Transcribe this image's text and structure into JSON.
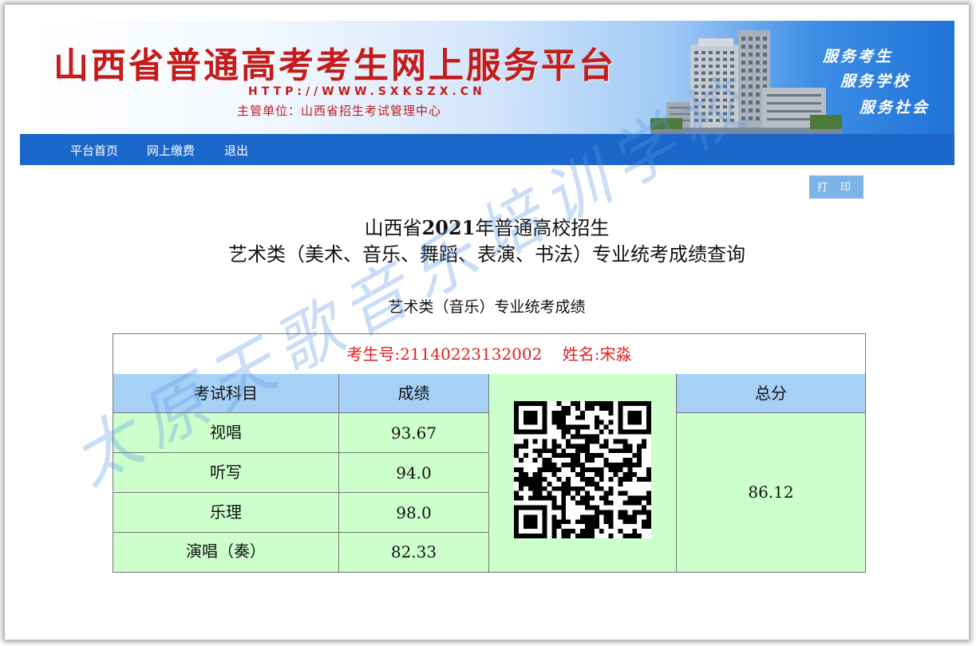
{
  "banner": {
    "title": "山西省普通高考考生网上服务平台",
    "url": "HTTP://WWW.SXKSZX.CN",
    "org": "主管单位：山西省招生考试管理中心",
    "slogans": [
      "服务考生",
      "服务学校",
      "服务社会"
    ]
  },
  "nav": {
    "items": [
      {
        "label": "平台首页"
      },
      {
        "label": "网上缴费"
      },
      {
        "label": "退出"
      }
    ]
  },
  "actions": {
    "print_label": "打 印"
  },
  "page": {
    "title_line1_pre": "山西省",
    "title_line1_year": "2021",
    "title_line1_post": "年普通高校招生",
    "title_line2": "艺术类（美术、音乐、舞蹈、表演、书法）专业统考成绩查询",
    "subtitle": "艺术类（音乐）专业统考成绩"
  },
  "result": {
    "candidate_line": "考生号:21140223132002    姓名:宋淼",
    "headers": {
      "subject": "考试科目",
      "score": "成绩",
      "total": "总分"
    },
    "rows": [
      {
        "subject": "视唱",
        "score": "93.67"
      },
      {
        "subject": "听写",
        "score": "94.0"
      },
      {
        "subject": "乐理",
        "score": "98.0"
      },
      {
        "subject": "演唱（奏）",
        "score": "82.33"
      }
    ],
    "total": "86.12"
  },
  "watermark": "太原天歌音乐培训学校",
  "colors": {
    "nav_bg": "#1b66c9",
    "title_red": "#c41b1b",
    "header_blue": "#a7d0f7",
    "cell_green": "#ccffcc",
    "candidate_red": "#e02020"
  }
}
